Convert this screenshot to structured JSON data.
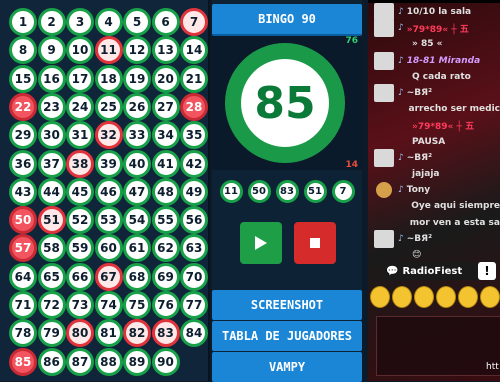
{
  "board": {
    "numbers": [
      1,
      2,
      3,
      4,
      5,
      6,
      7,
      8,
      9,
      10,
      11,
      12,
      13,
      14,
      15,
      16,
      17,
      18,
      19,
      20,
      21,
      22,
      23,
      24,
      25,
      26,
      27,
      28,
      29,
      30,
      31,
      32,
      33,
      34,
      35,
      36,
      37,
      38,
      39,
      40,
      41,
      42,
      43,
      44,
      45,
      46,
      47,
      48,
      49,
      50,
      51,
      52,
      53,
      54,
      55,
      56,
      57,
      58,
      59,
      60,
      61,
      62,
      63,
      64,
      65,
      66,
      67,
      68,
      69,
      70,
      71,
      72,
      73,
      74,
      75,
      76,
      77,
      78,
      79,
      80,
      81,
      82,
      83,
      84,
      85,
      86,
      87,
      88,
      89,
      90
    ],
    "drawn": [
      7,
      11,
      22,
      28,
      32,
      38,
      50,
      51,
      57,
      67,
      80,
      82,
      83,
      85
    ]
  },
  "game": {
    "title": "BINGO 90",
    "current_ball": "85",
    "remaining_count": "76",
    "drawn_count": "14",
    "recent_balls": [
      "11",
      "50",
      "83",
      "51",
      "7"
    ],
    "buttons": {
      "screenshot": "SCREENSHOT",
      "players": "TABLA DE JUGADORES",
      "vampy": "VAMPY"
    }
  },
  "chat": {
    "messages": [
      {
        "name": "10/10 la sala",
        "style": "gray",
        "icon": "avatar"
      },
      {
        "name": "»79*89«   ┼ 五",
        "style": "red",
        "icon": "avatar"
      },
      {
        "name": "» 85 «",
        "style": "gray",
        "icon": "none"
      },
      {
        "name": "18-81 Miranda",
        "style": "purple",
        "icon": "avatar"
      },
      {
        "name": "Q cada rato",
        "style": "gray",
        "icon": "none"
      },
      {
        "name": "~ВЯ²",
        "style": "gray",
        "icon": "avatar"
      },
      {
        "name": "arrecho ser medic",
        "style": "gray",
        "icon": "none"
      },
      {
        "name": "»79*89«   ┼ 五",
        "style": "red",
        "icon": "none"
      },
      {
        "name": "PAUSA",
        "style": "gray",
        "icon": "none"
      },
      {
        "name": "~ВЯ²",
        "style": "gray",
        "icon": "avatar"
      },
      {
        "name": "jajaja",
        "style": "gray",
        "icon": "none"
      },
      {
        "name": "Tony",
        "style": "gray",
        "icon": "face"
      },
      {
        "name": "Oye aqui siempre",
        "style": "gray",
        "icon": "none"
      },
      {
        "name": "mor ven a esta sa",
        "style": "gray",
        "icon": "none"
      },
      {
        "name": "~ВЯ²",
        "style": "gray",
        "icon": "avatar"
      },
      {
        "name": "😊",
        "style": "gray",
        "icon": "none"
      }
    ],
    "radio_label": "RadioFiest",
    "alert_label": "!",
    "link_label": "htt"
  }
}
